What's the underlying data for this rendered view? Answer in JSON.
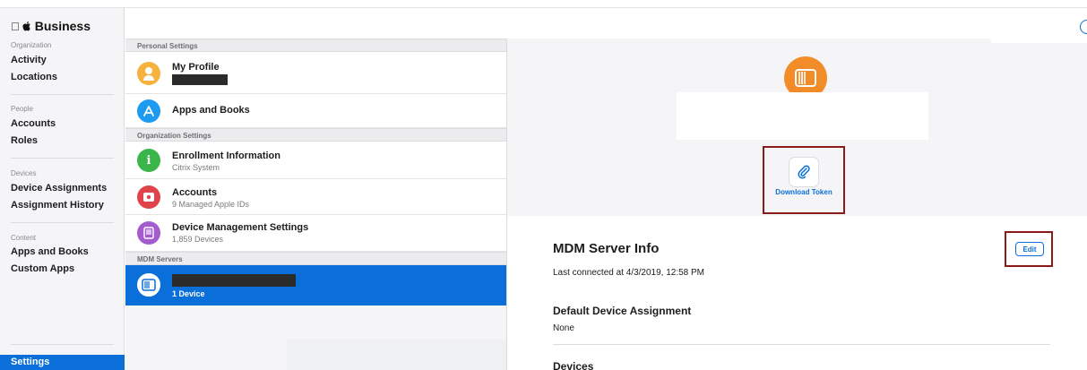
{
  "sidebar": {
    "brand": "Business",
    "sections": [
      {
        "label": "Organization",
        "items": [
          "Activity",
          "Locations"
        ]
      },
      {
        "label": "People",
        "items": [
          "Accounts",
          "Roles"
        ]
      },
      {
        "label": "Devices",
        "items": [
          "Device Assignments",
          "Assignment History"
        ]
      },
      {
        "label": "Content",
        "items": [
          "Apps and Books",
          "Custom Apps"
        ]
      }
    ],
    "active": "Settings"
  },
  "middle": {
    "personal_settings_header": "Personal Settings",
    "my_profile": "My Profile",
    "apps_and_books": "Apps and Books",
    "org_settings_header": "Organization Settings",
    "enrollment": {
      "title": "Enrollment Information",
      "sub": "Citrix System"
    },
    "accounts": {
      "title": "Accounts",
      "sub": "9 Managed Apple IDs"
    },
    "device_mgmt": {
      "title": "Device Management Settings",
      "sub": "1,859 Devices"
    },
    "mdm_servers_header": "MDM Servers",
    "mdm_server": {
      "sub": "1 Device"
    }
  },
  "detail": {
    "download_token": "Download Token",
    "info_title": "MDM Server Info",
    "last_connected": "Last connected at 4/3/2019, 12:58 PM",
    "edit_label": "Edit",
    "default_assignment_title": "Default Device Assignment",
    "default_assignment_value": "None",
    "devices_title": "Devices"
  },
  "colors": {
    "accent": "#0a6fd8",
    "profile_icon": "#f6b23c",
    "apps_icon": "#1e9bf0",
    "enrollment_icon": "#3ab54a",
    "accounts_icon": "#e0434b",
    "device_mgmt_icon": "#a45bd0",
    "server_icon": "#f28c28",
    "highlight_frame": "#8b1a1a"
  }
}
